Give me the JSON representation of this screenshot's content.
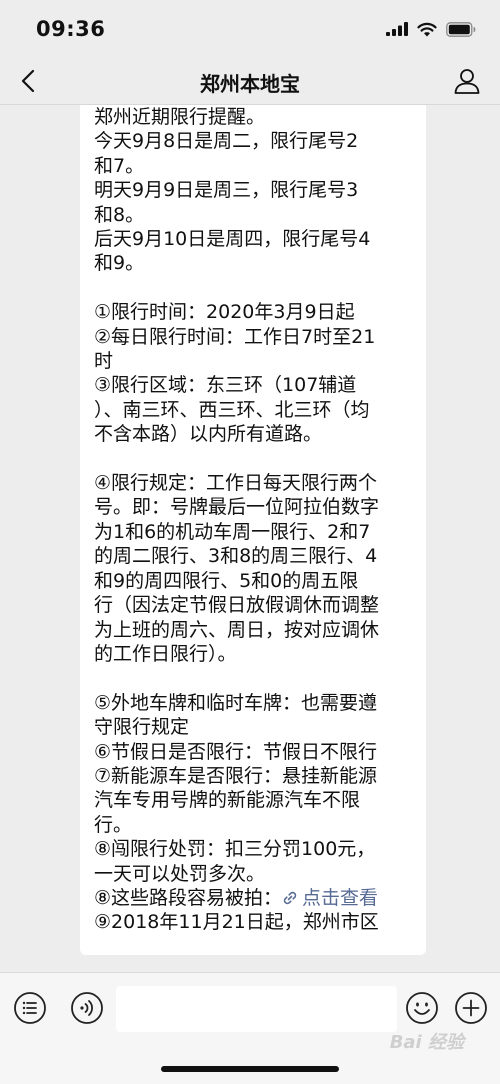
{
  "status_bar": {
    "time": "09:36",
    "icons": [
      "signal-icon",
      "wifi-icon",
      "battery-icon"
    ]
  },
  "nav": {
    "title": "郑州本地宝",
    "back_icon": "chevron-left-icon",
    "profile_icon": "user-icon"
  },
  "message": {
    "lines": [
      "郑州近期限行提醒。",
      "今天9月8日是周二，限行尾号2",
      "和7。",
      "明天9月9日是周三，限行尾号3",
      "和8。",
      "后天9月10日是周四，限行尾号4",
      "和9。",
      "",
      "①限行时间：2020年3月9日起",
      "②每日限行时间：工作日7时至21",
      "时",
      "③限行区域：东三环（107辅道",
      "）、南三环、西三环、北三环（均",
      "不含本路）以内所有道路。",
      "",
      "④限行规定：工作日每天限行两个",
      "号。即：号牌最后一位阿拉伯数字",
      "为1和6的机动车周一限行、2和7",
      "的周二限行、3和8的周三限行、4",
      "和9的周四限行、5和0的周五限",
      "行（因法定节假日放假调休而调整",
      "为上班的周六、周日，按对应调休",
      "的工作日限行）。",
      "",
      "⑤外地车牌和临时车牌：也需要遵",
      "守限行规定",
      "⑥节假日是否限行：节假日不限行",
      "⑦新能源车是否限行：悬挂新能源",
      "汽车专用号牌的新能源汽车不限",
      "行。",
      "⑧闯限行处罚：扣三分罚100元，",
      "一天可以处罚多次。"
    ],
    "link_line_prefix": "⑧这些路段容易被拍：",
    "link_text": "点击查看",
    "last_line": "⑨2018年11月21日起，郑州市区"
  },
  "input_bar": {
    "voice_icon": "voice-icon",
    "menu_icon": "list-menu-icon",
    "emoji_icon": "emoji-icon",
    "plus_icon": "plus-icon"
  },
  "watermark": "Bai 经验",
  "colors": {
    "background": "#ededed",
    "bubble": "#ffffff",
    "link": "#576b95"
  }
}
